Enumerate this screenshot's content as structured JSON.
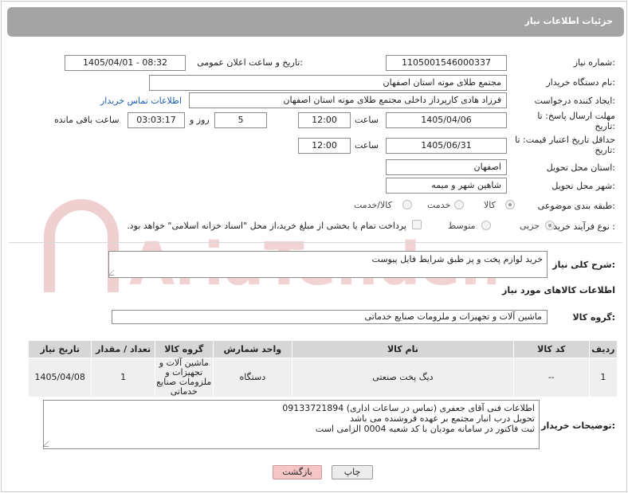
{
  "header": {
    "title": "جزئیات اطلاعات نیاز"
  },
  "fields": {
    "need_number_label": "شماره نیاز:",
    "need_number": "1105001546000337",
    "announce_label": "تاریخ و ساعت اعلان عمومی:",
    "announce_value": "1405/04/01 - 08:32",
    "buyer_org_label": "نام دستگاه خریدار:",
    "buyer_org": "مجتمع طلای موته استان اصفهان",
    "creator_label": "ایجاد کننده درخواست:",
    "creator": "فرزاد هادی کارپرداز داخلی مجتمع طلای موته استان اصفهان",
    "contact_link": "اطلاعات تماس خریدار",
    "deadline_label": "مهلت ارسال پاسخ: تا تاریخ:",
    "deadline_date": "1405/04/06",
    "time_label": "ساعت",
    "deadline_time": "12:00",
    "days_value": "5",
    "days_label": "روز و",
    "remaining_value": "03:03:17",
    "remaining_label": "ساعت باقی مانده",
    "price_validity_label": "حداقل تاریخ اعتبار قیمت: تا تاریخ:",
    "price_validity_date": "1405/06/31",
    "price_validity_time": "12:00",
    "province_label": "استان محل تحویل:",
    "province": "اصفهان",
    "city_label": "شهر محل تحویل:",
    "city": "شاهین شهر و میمه",
    "category_label": "طبقه بندی موضوعی:",
    "category_options": [
      "کالا",
      "خدمت",
      "کالا/خدمت"
    ],
    "process_label": "نوع فرآیند خرید :",
    "process_options": [
      "جزیی",
      "متوسط"
    ],
    "payment_note": "پرداخت تمام یا بخشی از مبلغ خرید،از محل \"اسناد خزانه اسلامی\" خواهد بود."
  },
  "description": {
    "label": "شرح کلی نیاز:",
    "value": "خرید لوازم پخت و پز طبق شرایط فایل پیوست"
  },
  "goods_section": {
    "title": "اطلاعات کالاهای مورد نیاز",
    "group_label": "گروه کالا:",
    "group_value": "ماشین آلات و تجهیزات و ملزومات صنایع خدماتی"
  },
  "table": {
    "headers": [
      "ردیف",
      "کد کالا",
      "نام کالا",
      "واحد شمارش",
      "گروه کالا",
      "تعداد / مقدار",
      "تاریخ نیاز"
    ],
    "rows": [
      [
        "1",
        "--",
        "دیگ پخت صنعتی",
        "دستگاه",
        "ماشین آلات و تجهیزات و ملزومات صنایع خدماتی",
        "1",
        "1405/04/08"
      ]
    ]
  },
  "buyer_notes": {
    "label": "توضیحات خریدار:",
    "lines": [
      "اطلاعات فنی آقای جعفری (تماس در ساعات اداری) 09133721894",
      "تحویل درب انبار مجتمع بر عهده فروشنده می باشد",
      "ثبت فاکتور در سامانه مودیان با کد شعبه 0004 الزامی است"
    ]
  },
  "buttons": {
    "print": "چاپ",
    "back": "بازگشت"
  },
  "watermark": {
    "text": "AriaTender.net"
  },
  "colors": {
    "header_bg": "#a4a4a4",
    "link": "#1a5fb4",
    "back_button": "#f5c6c6",
    "watermark": "#e8b9b9"
  }
}
